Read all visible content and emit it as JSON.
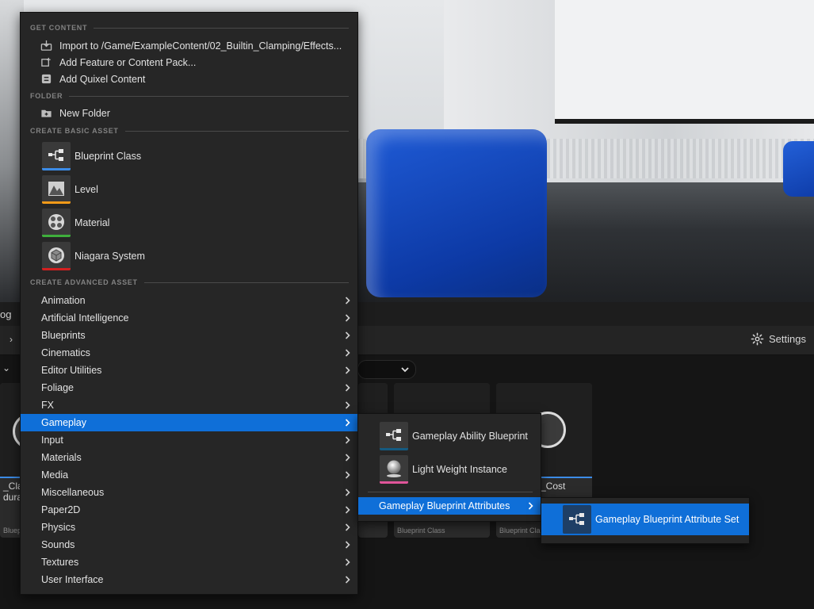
{
  "background": {
    "toolbar_fragment": "og",
    "content_bar_fragment": "›",
    "settings_label": "Settings",
    "filter_fragment": "⌄",
    "assets": [
      {
        "name": "_Clar",
        "name2": "duran",
        "kind": "Blueprint C"
      },
      {
        "name": "",
        "kind": ""
      },
      {
        "name": "",
        "kind": "Blueprint Class"
      },
      {
        "name": "_Cost",
        "kind": "Blueprint Cla"
      }
    ]
  },
  "menu": {
    "sections": {
      "get_content": "GET CONTENT",
      "folder": "FOLDER",
      "create_basic": "CREATE BASIC ASSET",
      "create_advanced": "CREATE ADVANCED ASSET"
    },
    "get_content_items": [
      {
        "label": "Import to /Game/ExampleContent/02_Builtin_Clamping/Effects...",
        "icon": "import-icon"
      },
      {
        "label": "Add Feature or Content Pack...",
        "icon": "content-pack-icon"
      },
      {
        "label": "Add Quixel Content",
        "icon": "quixel-icon"
      }
    ],
    "folder_items": [
      {
        "label": "New Folder",
        "icon": "new-folder-icon"
      }
    ],
    "basic_assets": [
      {
        "label": "Blueprint Class",
        "icon": "blueprint-icon",
        "color": "#3c8ce7"
      },
      {
        "label": "Level",
        "icon": "level-icon",
        "color": "#f29a18"
      },
      {
        "label": "Material",
        "icon": "material-icon",
        "color": "#3fae3c"
      },
      {
        "label": "Niagara System",
        "icon": "niagara-icon",
        "color": "#d42020"
      }
    ],
    "advanced_items": [
      "Animation",
      "Artificial Intelligence",
      "Blueprints",
      "Cinematics",
      "Editor Utilities",
      "Foliage",
      "FX",
      "Gameplay",
      "Input",
      "Materials",
      "Media",
      "Miscellaneous",
      "Paper2D",
      "Physics",
      "Sounds",
      "Textures",
      "User Interface"
    ],
    "selected_advanced": "Gameplay",
    "selection_color": "#0f6fd8"
  },
  "gameplay_submenu": {
    "items": [
      {
        "label": "Gameplay Ability Blueprint",
        "icon": "blueprint-icon",
        "color": "#155a80"
      },
      {
        "label": "Light Weight Instance",
        "icon": "sphere-icon",
        "color": "#e0559a"
      }
    ],
    "attributes_label": "Gameplay Blueprint Attributes"
  },
  "attributes_submenu": {
    "item_label": "Gameplay Blueprint Attribute Set",
    "icon": "blueprint-icon"
  }
}
